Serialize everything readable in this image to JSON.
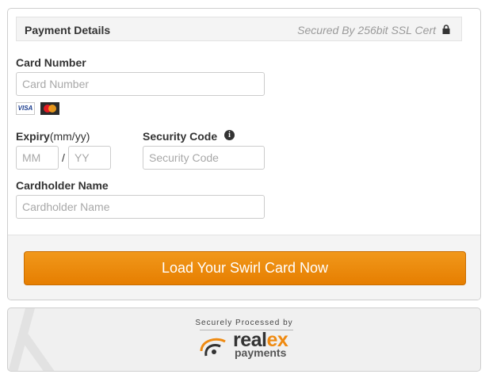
{
  "header": {
    "title": "Payment Details",
    "secure_text": "Secured By 256bit SSL Cert"
  },
  "form": {
    "card_number": {
      "label": "Card Number",
      "placeholder": "Card Number"
    },
    "card_logos": {
      "visa": "VISA"
    },
    "expiry": {
      "label": "Expiry",
      "hint": "(mm/yy)",
      "month_placeholder": "MM",
      "separator": "/",
      "year_placeholder": "YY"
    },
    "security_code": {
      "label": "Security Code",
      "placeholder": "Security Code",
      "info_icon": "i"
    },
    "cardholder": {
      "label": "Cardholder Name",
      "placeholder": "Cardholder Name"
    }
  },
  "submit": {
    "label": "Load Your Swirl Card Now"
  },
  "footer": {
    "processed_by": "Securely Processed by",
    "brand_main": "real",
    "brand_accent": "ex",
    "brand_sub": "payments"
  },
  "colors": {
    "accent": "#ef8a11",
    "button_top": "#f1981b",
    "button_bottom": "#e67e00"
  }
}
